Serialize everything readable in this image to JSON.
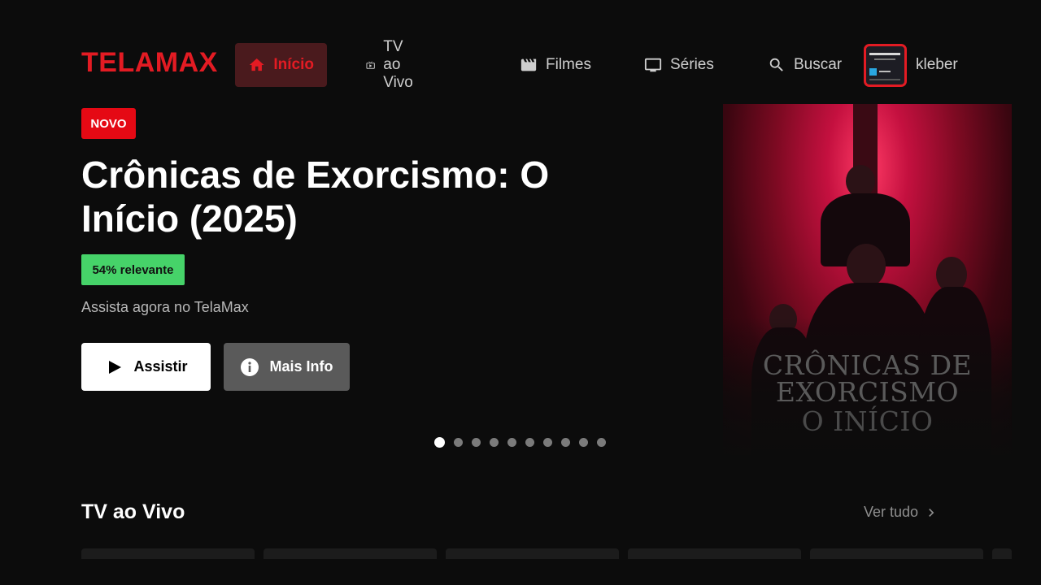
{
  "colors": {
    "brand": "#e31b23",
    "nav_active_bg": "#4a1a1d",
    "badge_new": "#e50914",
    "badge_relevance": "#46d369"
  },
  "header": {
    "logo": "TELAMAX",
    "nav": [
      {
        "label": "Início",
        "icon": "home-icon",
        "active": true
      },
      {
        "label": "TV ao Vivo",
        "icon": "live-tv-icon",
        "active": false
      },
      {
        "label": "Filmes",
        "icon": "movie-clapper-icon",
        "active": false
      },
      {
        "label": "Séries",
        "icon": "tv-monitor-icon",
        "active": false
      },
      {
        "label": "Buscar",
        "icon": "search-icon",
        "active": false
      }
    ],
    "username": "kleber"
  },
  "hero": {
    "badge": "NOVO",
    "title": "Crônicas de Exorcismo: O Início (2025)",
    "relevance": "54% relevante",
    "subtitle": "Assista agora no TelaMax",
    "play_label": "Assistir",
    "info_label": "Mais Info",
    "carousel_total": 10,
    "carousel_active": 1,
    "poster_text": [
      "CRÔNICAS DE",
      "EXORCISMO",
      "O INÍCIO"
    ]
  },
  "row": {
    "title": "TV ao Vivo",
    "see_all": "Ver tudo"
  }
}
